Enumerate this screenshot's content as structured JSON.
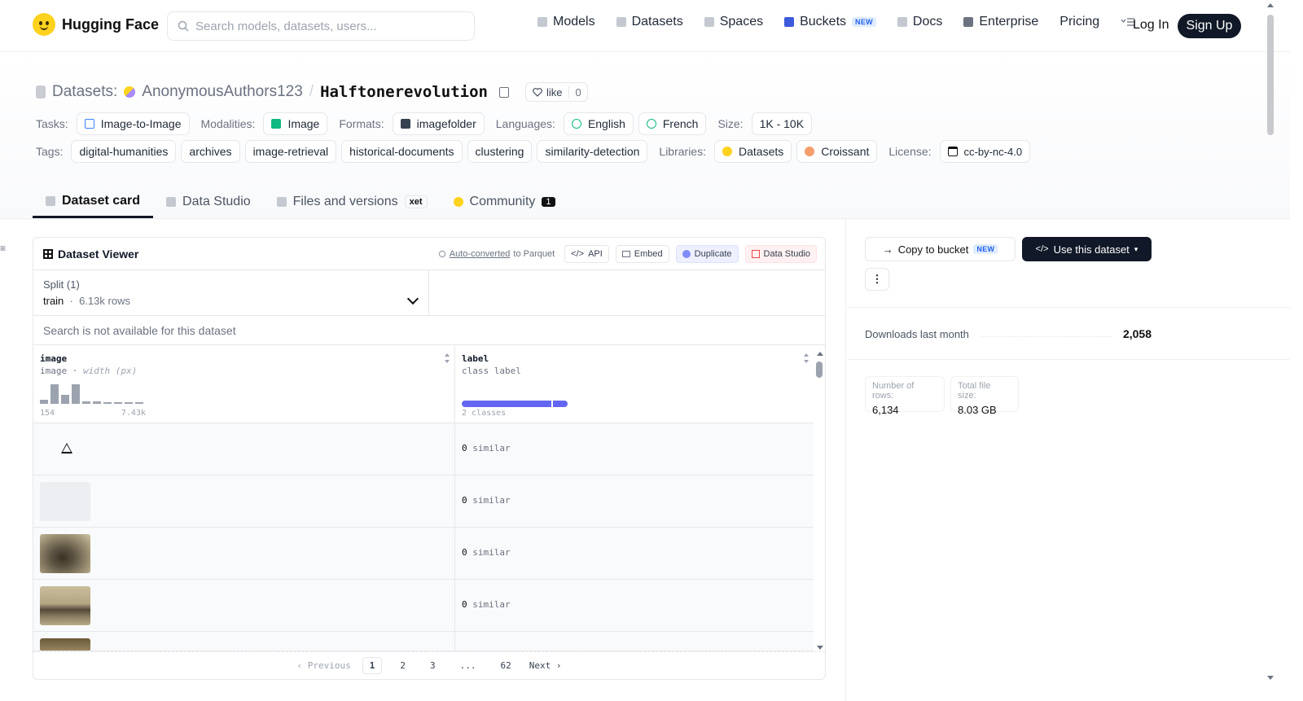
{
  "nav": {
    "brand": "Hugging Face",
    "search_placeholder": "Search models, datasets, users...",
    "links": [
      "Models",
      "Datasets",
      "Spaces",
      "Buckets",
      "Docs",
      "Enterprise",
      "Pricing"
    ],
    "new_badge": "NEW",
    "login": "Log In",
    "signup": "Sign Up"
  },
  "header": {
    "section": "Datasets:",
    "owner": "AnonymousAuthors123",
    "separator": "/",
    "repo": "Halftonerevolution",
    "like_label": "like",
    "like_count": "0"
  },
  "meta": {
    "tasks_label": "Tasks:",
    "task": "Image-to-Image",
    "modalities_label": "Modalities:",
    "modality": "Image",
    "formats_label": "Formats:",
    "format": "imagefolder",
    "languages_label": "Languages:",
    "languages": [
      "English",
      "French"
    ],
    "size_label": "Size:",
    "size": "1K - 10K",
    "tags_label": "Tags:",
    "tags": [
      "digital-humanities",
      "archives",
      "image-retrieval",
      "historical-documents",
      "clustering",
      "similarity-detection"
    ],
    "libraries_label": "Libraries:",
    "libraries": [
      "Datasets",
      "Croissant"
    ],
    "license_label": "License:",
    "license": "cc-by-nc-4.0"
  },
  "tabs": [
    {
      "label": "Dataset card"
    },
    {
      "label": "Data Studio"
    },
    {
      "label": "Files and versions",
      "badge": "xet"
    },
    {
      "label": "Community",
      "count": "1"
    }
  ],
  "viewer": {
    "title": "Dataset Viewer",
    "auto_converted": "Auto-converted",
    "to_parquet": "to Parquet",
    "actions": [
      "API",
      "Embed",
      "Duplicate",
      "Data Studio"
    ],
    "split_label": "Split (1)",
    "split_name": "train",
    "split_rows": "6.13k rows",
    "search_na": "Search is not available for this dataset",
    "columns": [
      {
        "name": "image",
        "type": "image",
        "subtype": "width (px)",
        "min": "154",
        "max": "7.43k"
      },
      {
        "name": "label",
        "type": "class label",
        "summary": "2 classes"
      }
    ],
    "histogram": [
      0.2,
      1.0,
      0.45,
      1.0,
      0.12,
      0.12,
      0.05,
      0.05,
      0.05,
      0.05
    ],
    "class_shares": [
      0.86,
      0.14
    ],
    "rows": [
      {
        "image": "warning",
        "label_count": "0",
        "label_name": "similar"
      },
      {
        "image": "placeholder",
        "label_count": "0",
        "label_name": "similar"
      },
      {
        "image": "photo-1",
        "label_count": "0",
        "label_name": "similar"
      },
      {
        "image": "photo-2",
        "label_count": "0",
        "label_name": "similar"
      },
      {
        "image": "photo-3"
      }
    ],
    "pager": {
      "prev": "Previous",
      "pages": [
        "1",
        "2",
        "3",
        "...",
        "62"
      ],
      "next": "Next"
    }
  },
  "sidebar": {
    "copy_bucket": "Copy to bucket",
    "use_dataset": "Use this dataset",
    "downloads_label": "Downloads last month",
    "downloads_value": "2,058",
    "rows_label": "Number of rows:",
    "rows_value": "6,134",
    "size_label": "Total file size:",
    "size_value": "8.03 GB"
  },
  "colors": {
    "accent": "#6366f1",
    "dark": "#111827",
    "brand": "#ffd21e"
  }
}
